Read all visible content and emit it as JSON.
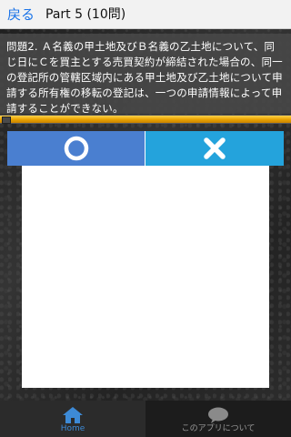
{
  "header": {
    "back_label": "戻る",
    "title": "Part 5 (10問)"
  },
  "question": {
    "text": "問題2. Ａ名義の甲土地及びＢ名義の乙土地について、同じ日にＣを買主とする売買契約が締結された場合の、同一の登記所の管轄区域内にある甲土地及び乙土地について申請する所有権の移転の登記は、一つの申請情報によって申請することができない。"
  },
  "progress": {
    "fraction": 1.0,
    "color": "#e8a100"
  },
  "answers": {
    "correct": {
      "icon": "circle-icon",
      "color": "#4a7fd0"
    },
    "wrong": {
      "icon": "cross-icon",
      "color": "#24a3dc"
    }
  },
  "bottom_nav": {
    "items": [
      {
        "label": "Home",
        "icon": "home-icon",
        "active": true
      },
      {
        "label": "このアプリについて",
        "icon": "speech-bubble-icon",
        "active": false
      }
    ],
    "active_color": "#3d8ad6"
  }
}
